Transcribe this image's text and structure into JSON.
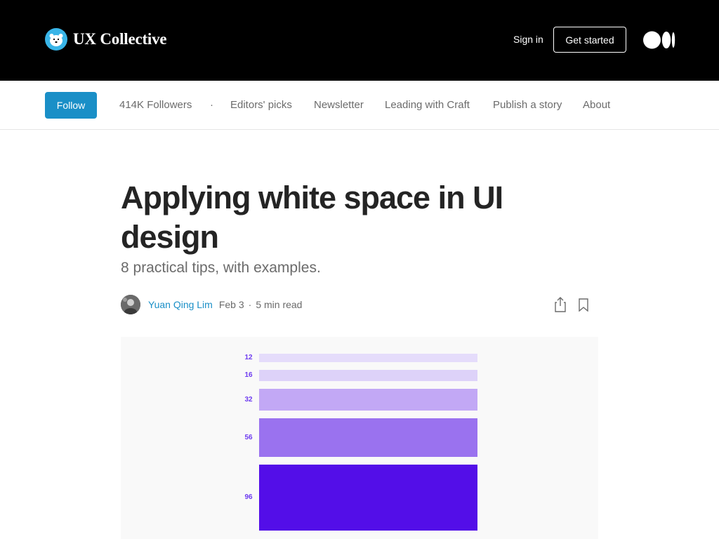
{
  "header": {
    "brand": "UX Collective",
    "sign_in": "Sign in",
    "get_started": "Get started"
  },
  "pubnav": {
    "follow": "Follow",
    "followers": "414K Followers",
    "separator": "·",
    "items": [
      "Editors' picks",
      "Newsletter",
      "Leading with Craft",
      "Publish a story",
      "About"
    ]
  },
  "article": {
    "title": "Applying white space in UI design",
    "subtitle": "8 practical tips, with examples.",
    "author": "Yuan Qing Lim",
    "date": "Feb 3",
    "dot": "·",
    "read_time": "5 min read"
  },
  "figure": {
    "bars": [
      {
        "label": "12",
        "value": 12,
        "color": "#e5dcfb"
      },
      {
        "label": "16",
        "value": 16,
        "color": "#ddd2f9"
      },
      {
        "label": "32",
        "value": 32,
        "color": "#c2a8f5"
      },
      {
        "label": "56",
        "value": 56,
        "color": "#9a72ef"
      },
      {
        "label": "96",
        "value": 96,
        "color": "#530ee8"
      }
    ]
  },
  "colors": {
    "accent": "#1a8fc7",
    "header_bg": "#000000",
    "brand_logo": "#39b5e8"
  },
  "icons": {
    "brand": "polar-bear-logo",
    "medium": "medium-logo",
    "share": "share-icon",
    "bookmark": "bookmark-icon"
  }
}
